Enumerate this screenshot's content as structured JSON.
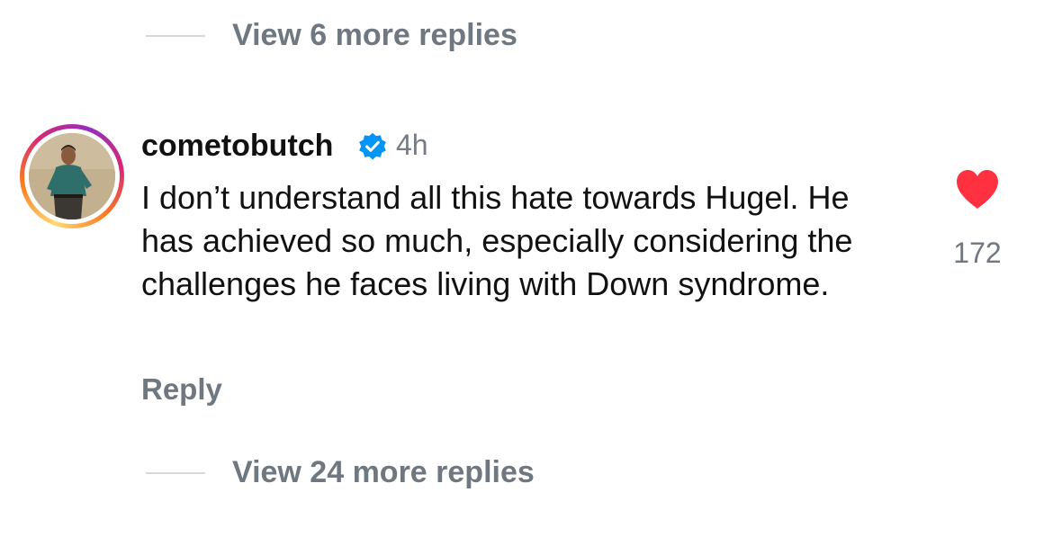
{
  "thread": {
    "view_more_top": "View 6 more replies",
    "view_more_bottom": "View 24 more replies"
  },
  "comment": {
    "username": "cometobutch",
    "verified": true,
    "time": "4h",
    "text": "I don’t understand all this hate towards Hugel. He has achieved so much, especially considering the challenges he faces living with Down syndrome.",
    "reply_label": "Reply",
    "like_count": "172",
    "liked": true,
    "icons": {
      "verified": "verified-badge-icon",
      "like": "heart-icon"
    }
  },
  "colors": {
    "heart": "#ff3040",
    "verified": "#0095f6",
    "muted_text": "#6f7780"
  }
}
